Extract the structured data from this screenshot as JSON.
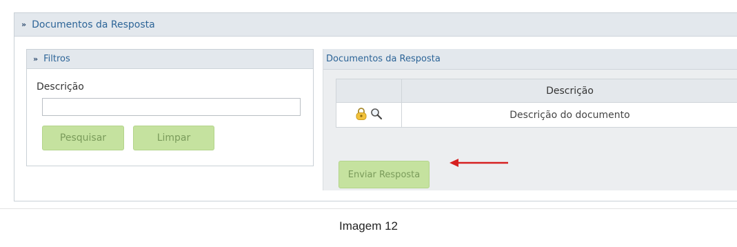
{
  "outer_panel": {
    "title": "Documentos da Resposta",
    "chevron": "»"
  },
  "filtros": {
    "title": "Filtros",
    "chevron": "»",
    "descricao_label": "Descrição",
    "descricao_value": "",
    "pesquisar_label": "Pesquisar",
    "limpar_label": "Limpar"
  },
  "documentos": {
    "title": "Documentos da Resposta",
    "table": {
      "headers": [
        "",
        "Descrição"
      ],
      "rows": [
        {
          "icons": [
            "lock-icon",
            "magnifier-icon"
          ],
          "descricao": "Descrição do documento"
        }
      ]
    },
    "enviar_label": "Enviar Resposta"
  },
  "annotation": {
    "arrow_color": "#d62020"
  },
  "colors": {
    "accent_text": "#2c6497",
    "button_green": "#c5e29f",
    "header_bg": "#e3e8ed"
  },
  "caption": "Imagem 12"
}
